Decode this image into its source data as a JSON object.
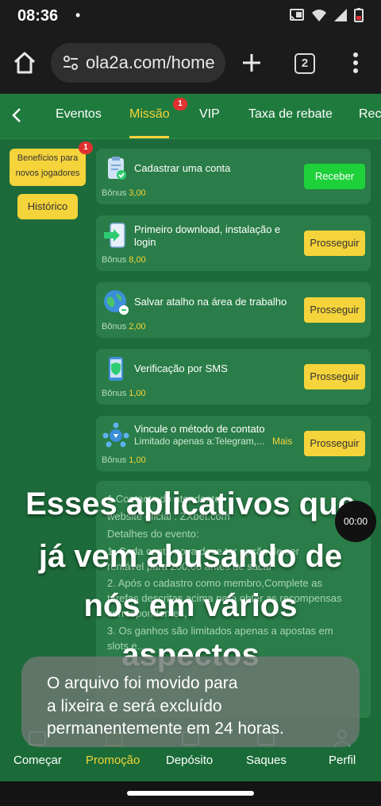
{
  "status_bar": {
    "time": "08:36",
    "dot": "•"
  },
  "browser": {
    "url": "ola2a.com/home",
    "tab_count": "2"
  },
  "nav_tabs": {
    "items": [
      "Eventos",
      "Missão",
      "VIP",
      "Taxa de rebate",
      "Rec"
    ],
    "active": "Missão",
    "missao_badge": "1"
  },
  "sidebar": {
    "benefits_line1": "Benefícios para",
    "benefits_line2": "novos jogadores",
    "benefits_badge": "1",
    "history": "Histórico"
  },
  "tasks": [
    {
      "title": "Cadastrar uma conta",
      "bonus_label": "Bônus",
      "bonus": "3,00",
      "button": "Receber"
    },
    {
      "title": "Primeiro download, instalação e login",
      "bonus_label": "Bônus",
      "bonus": "8,00",
      "button": "Prosseguir"
    },
    {
      "title": "Salvar atalho na área de trabalho",
      "bonus_label": "Bônus",
      "bonus": "2,00",
      "button": "Prosseguir"
    },
    {
      "title": "Verificação por SMS",
      "bonus_label": "Bônus",
      "bonus": "1,00",
      "button": "Prosseguir"
    },
    {
      "title": "Vincule o método de contato",
      "subtitle": "Limitado apenas a:Telegram,...",
      "more": "Mais",
      "bonus_label": "Bônus",
      "bonus": "1,00",
      "button": "Prosseguir"
    }
  ],
  "details": {
    "lines": [
      "1.Contacto do atendente",
      "website oficial : ZXbet.com",
      "Detalhes do evento:",
      "1. Cada conta nova deve ter opção de ser",
      "rentável para 200,00 antes de sacar",
      "2. Após o cadastro como membro,Complete as",
      "tarefas descritas acima para obter as recompensas",
      "correspondentes,",
      "3. Os ganhos são limitados apenas a apostas em",
      "slots e..."
    ]
  },
  "overlay": {
    "lines": [
      "Esses aplicativos que",
      "já vem abusando de",
      "nós em vários",
      "aspectos"
    ],
    "timer": "00:00"
  },
  "bottom_nav": [
    "Começar",
    "Promoção",
    "Depósito",
    "Saques",
    "Perfil"
  ],
  "bottom_nav_active": "Promoção",
  "toast": {
    "lines": [
      "O arquivo foi movido para",
      "a lixeira e será excluído",
      "permanentemente em 24 horas."
    ]
  }
}
